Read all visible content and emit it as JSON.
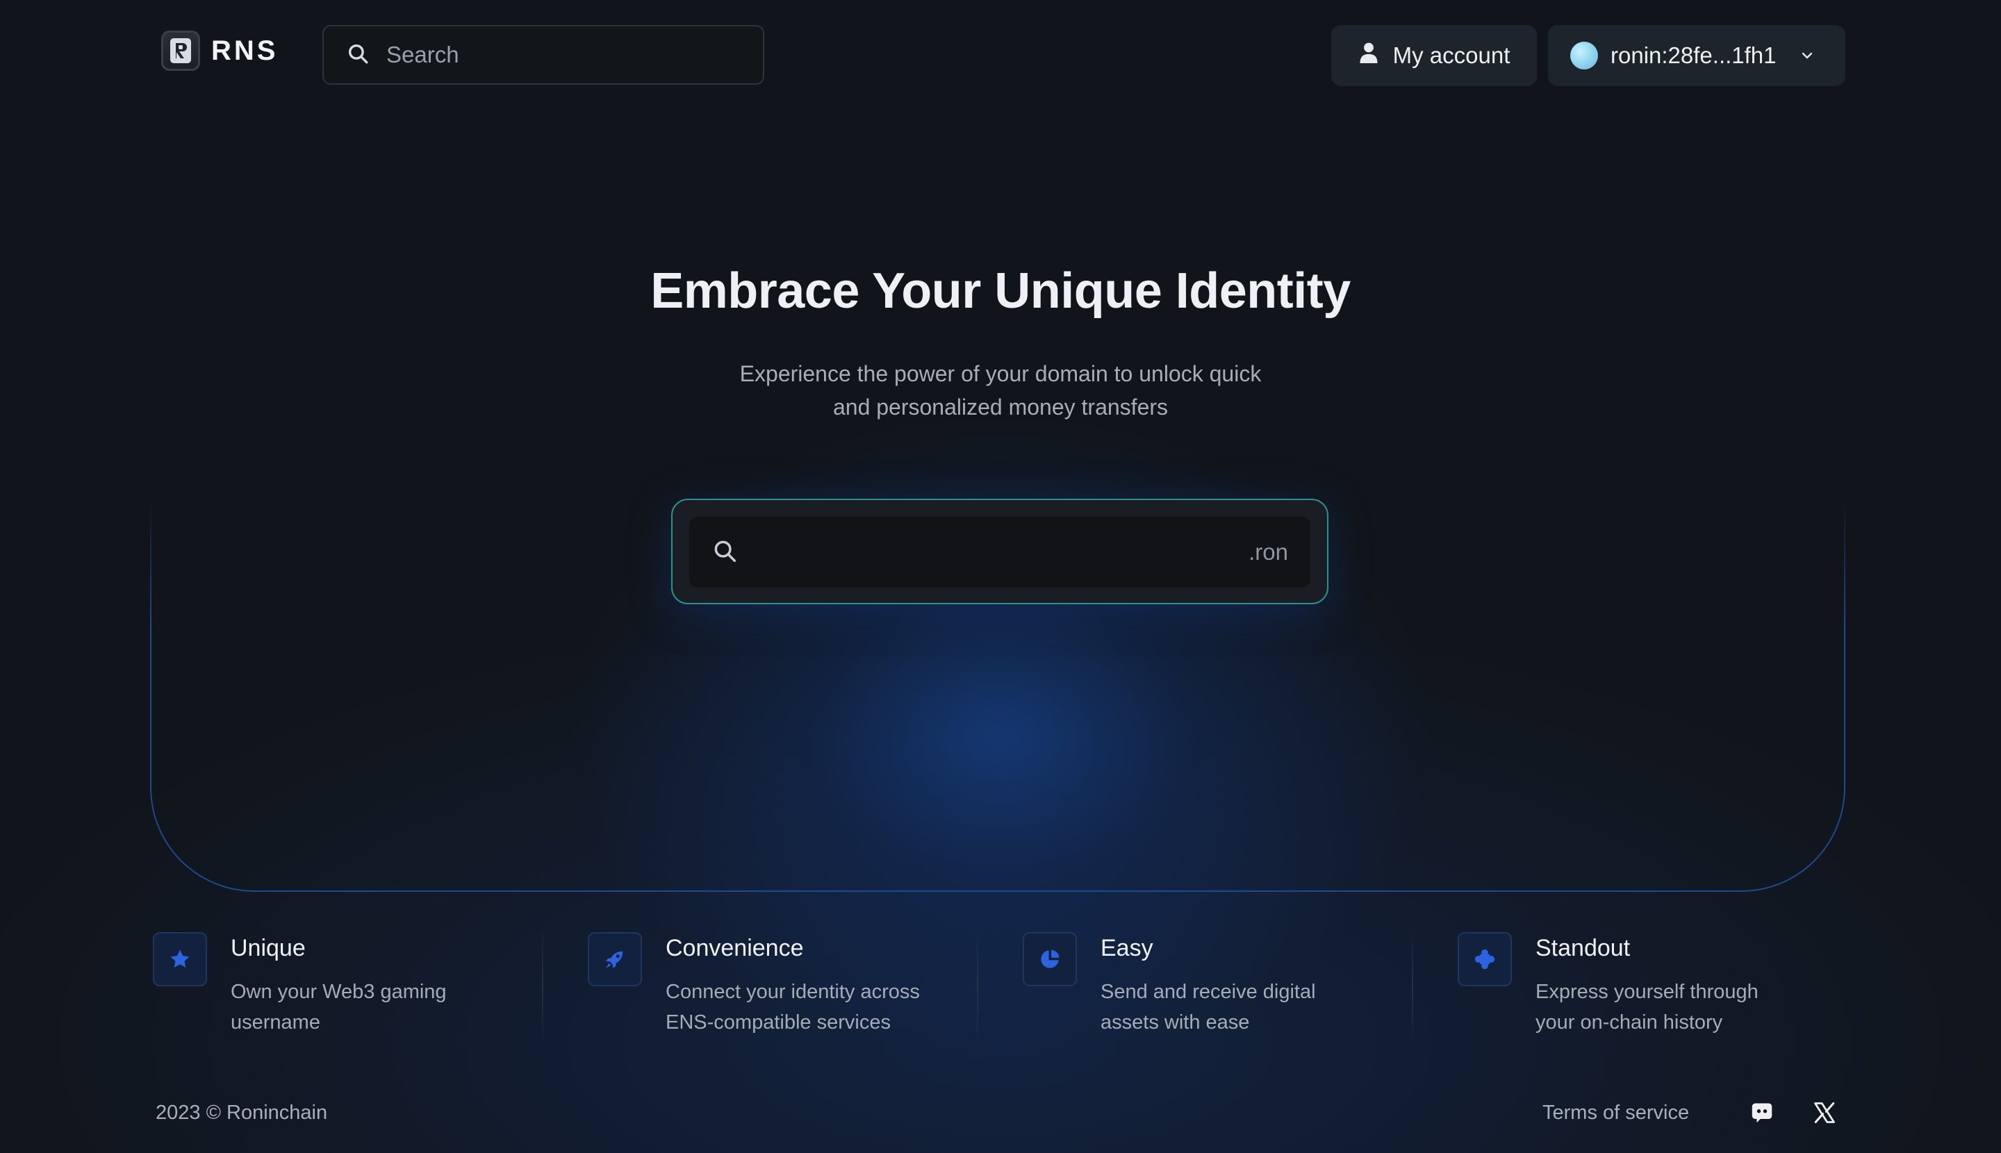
{
  "header": {
    "logo_text": "RNS",
    "search_placeholder": "Search",
    "account_label": "My account",
    "wallet_label": "ronin:28fe...1fh1"
  },
  "hero": {
    "title": "Embrace Your Unique Identity",
    "subtitle_line1": "Experience the power of your domain to unlock quick",
    "subtitle_line2": "and personalized money transfers",
    "domain_input_value": "",
    "domain_suffix": ".ron"
  },
  "features": [
    {
      "icon": "star-icon",
      "title": "Unique",
      "desc_line1": "Own your Web3 gaming",
      "desc_line2": "username"
    },
    {
      "icon": "rocket-icon",
      "title": "Convenience",
      "desc_line1": "Connect your identity across",
      "desc_line2": "ENS-compatible services"
    },
    {
      "icon": "pie-icon",
      "title": "Easy",
      "desc_line1": "Send and receive digital",
      "desc_line2": "assets with ease"
    },
    {
      "icon": "puzzle-icon",
      "title": "Standout",
      "desc_line1": "Express yourself through",
      "desc_line2": "your on-chain history"
    }
  ],
  "footer": {
    "copyright": "2023 © Roninchain",
    "terms_label": "Terms of service",
    "social": [
      "discord-icon",
      "x-icon"
    ]
  },
  "colors": {
    "background": "#11151b",
    "accent_blue": "#2a5fd6",
    "search_border": "#2f8f8a",
    "button_bg": "#1e242c"
  }
}
